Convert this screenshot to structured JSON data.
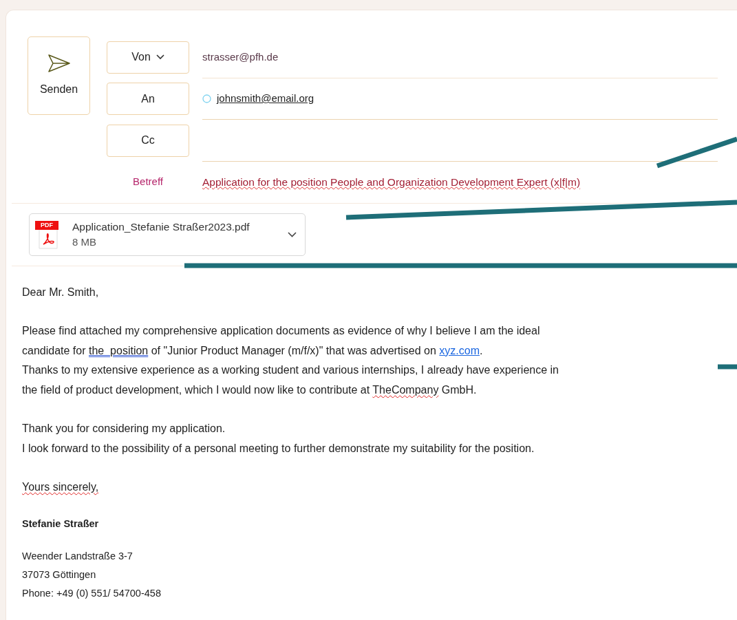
{
  "send_button": {
    "label": "Senden"
  },
  "header_fields": [
    {
      "kind": "from",
      "label": "Von",
      "value": "strasser@pfh.de"
    },
    {
      "kind": "to",
      "label": "An",
      "value": "johnsmith@email.org"
    },
    {
      "kind": "cc",
      "label": "Cc"
    }
  ],
  "subject": {
    "label": "Betreff",
    "value": "Application for the position People and Organization Development Expert (x|f|m)"
  },
  "attachment": {
    "name": "Application_Stefanie Straßer2023.pdf",
    "size": "8 MB",
    "badge": "PDF"
  },
  "body": [
    {
      "lines": [
        [
          {
            "kind": "text",
            "text": "Dear Mr. Smith,"
          }
        ]
      ]
    },
    {
      "lines": [
        [
          {
            "kind": "text",
            "text": "Please find attached my comprehensive application documents as evidence of why I believe I am the ideal"
          }
        ],
        [
          {
            "kind": "text",
            "text": "candidate for "
          },
          {
            "kind": "grammar",
            "text": "the  position"
          },
          {
            "kind": "text",
            "text": " of \"Junior Product Manager (m/f/x)\" that was advertised on "
          },
          {
            "kind": "link",
            "text": "xyz.com"
          },
          {
            "kind": "text",
            "text": "."
          }
        ],
        [
          {
            "kind": "text",
            "text": "Thanks to my extensive experience as a working student and various internships, I already have experience in"
          }
        ],
        [
          {
            "kind": "text",
            "text": "the field of product development, which I would now like to contribute at "
          },
          {
            "kind": "misspelled",
            "text": "TheCompany"
          },
          {
            "kind": "text",
            "text": " GmbH."
          }
        ]
      ]
    },
    {
      "lines": [
        [
          {
            "kind": "text",
            "text": "Thank you for considering my application."
          }
        ],
        [
          {
            "kind": "text",
            "text": "I look forward to the possibility of a personal meeting to further demonstrate my suitability for the position."
          }
        ]
      ]
    },
    {
      "lines": [
        [
          {
            "kind": "misspelled",
            "text": "Yours sincerely,"
          }
        ]
      ]
    }
  ],
  "signature": {
    "name": "Stefanie Straßer",
    "address": [
      "Weender Landstraße 3-7",
      "37073 Göttingen",
      "Phone: +49 (0) 551/ 54700-458"
    ]
  }
}
